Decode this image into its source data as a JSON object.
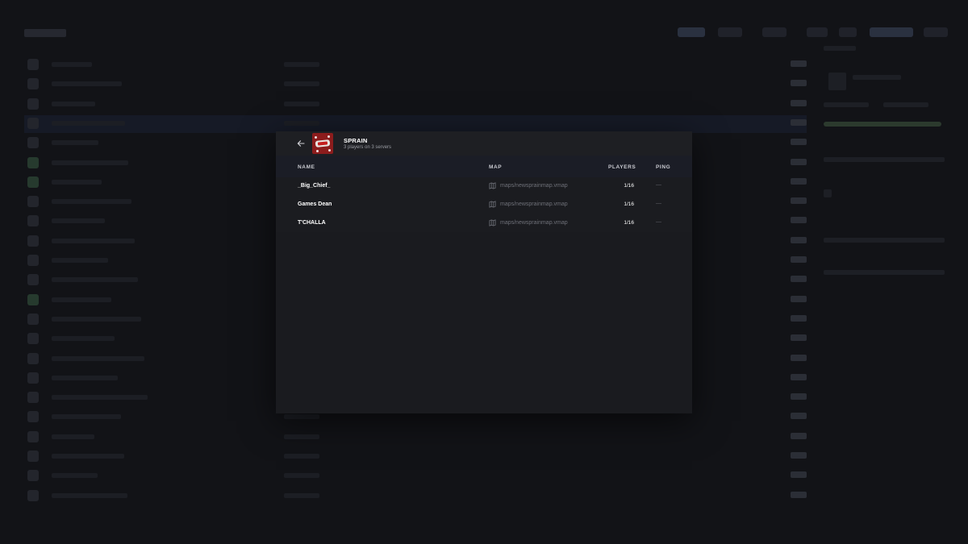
{
  "modal": {
    "title": "SPRAIN",
    "subtitle": "3 players on 3 servers",
    "back_icon": "arrow-left-icon",
    "columns": {
      "name": "NAME",
      "map": "MAP",
      "players": "PLAYERS",
      "ping": "PING"
    },
    "rows": [
      {
        "name": "_Big_Chief_",
        "map": "maps/newsprainmap.vmap",
        "players": "1/16",
        "ping": "—"
      },
      {
        "name": "Games Dean",
        "map": "maps/newsprainmap.vmap",
        "players": "1/16",
        "ping": "—"
      },
      {
        "name": "T'CHALLA",
        "map": "maps/newsprainmap.vmap",
        "players": "1/16",
        "ping": "—"
      }
    ]
  },
  "colors": {
    "page_background": "#121317",
    "modal_background": "#1a1b1f",
    "header_row_background": "#1b1d26",
    "muted_text": "#6e7078"
  }
}
